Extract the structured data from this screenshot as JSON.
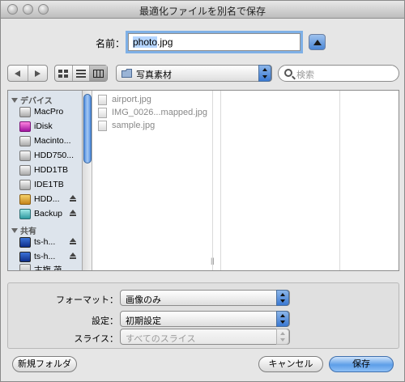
{
  "window": {
    "title": "最適化ファイルを別名で保存"
  },
  "name_row": {
    "label": "名前：",
    "value_selected": "photo",
    "value_rest": ".jpg"
  },
  "toolbar": {
    "location_popup": "写真素材",
    "search_placeholder": "検索"
  },
  "sidebar": {
    "devices_header": "デバイス",
    "devices": [
      {
        "label": "MacPro",
        "icon": "hard-disk-icon"
      },
      {
        "label": "iDisk",
        "icon": "idisk-icon"
      },
      {
        "label": "Macinto...",
        "icon": "hard-disk-icon"
      },
      {
        "label": "HDD750...",
        "icon": "hard-disk-icon"
      },
      {
        "label": "HDD1TB",
        "icon": "hard-disk-icon"
      },
      {
        "label": "IDE1TB",
        "icon": "hard-disk-icon"
      },
      {
        "label": "HDD...",
        "icon": "usb-drive-icon"
      },
      {
        "label": "Backup",
        "icon": "backup-disk-icon"
      }
    ],
    "shared_header": "共有",
    "shared": [
      {
        "label": "ts-h...",
        "icon": "network-computer-icon"
      },
      {
        "label": "ts-h...",
        "icon": "network-computer-icon"
      },
      {
        "label": "古旗 茂...",
        "icon": "network-server-icon"
      }
    ]
  },
  "files": [
    {
      "name": "airport.jpg"
    },
    {
      "name": "IMG_0026...mapped.jpg"
    },
    {
      "name": "sample.jpg"
    }
  ],
  "options": {
    "format_label": "フォーマット：",
    "format_value": "画像のみ",
    "settings_label": "設定：",
    "settings_value": "初期設定",
    "slice_label": "スライス：",
    "slice_value": "すべてのスライス"
  },
  "buttons": {
    "new_folder": "新規フォルダ",
    "cancel": "キャンセル",
    "save": "保存"
  }
}
